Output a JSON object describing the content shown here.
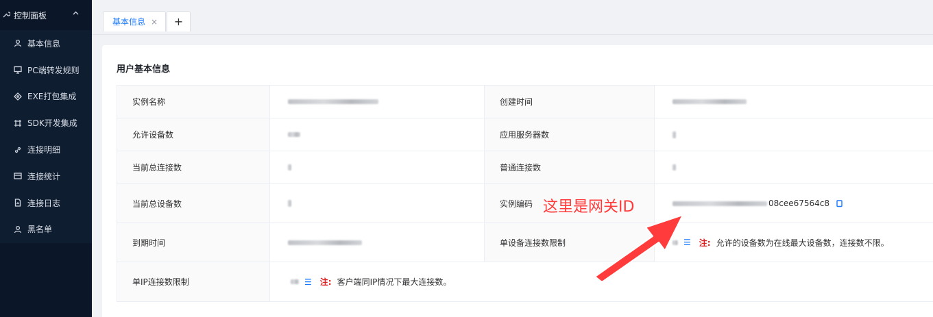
{
  "sidebar": {
    "header": {
      "label": "控制面板",
      "icon": "wrench-icon",
      "chevron": "chevron-up-icon"
    },
    "items": [
      {
        "label": "基本信息",
        "icon": "user-icon"
      },
      {
        "label": "PC端转发规则",
        "icon": "monitor-icon"
      },
      {
        "label": "EXE打包集成",
        "icon": "diamond-icon"
      },
      {
        "label": "SDK开发集成",
        "icon": "frame-icon"
      },
      {
        "label": "连接明细",
        "icon": "link-icon"
      },
      {
        "label": "连接统计",
        "icon": "table-icon"
      },
      {
        "label": "连接日志",
        "icon": "file-icon"
      },
      {
        "label": "黑名单",
        "icon": "user-icon"
      }
    ]
  },
  "tabs": {
    "active_label": "基本信息",
    "close_glyph": "×",
    "add_glyph": "+"
  },
  "card": {
    "title": "用户基本信息",
    "rows": [
      {
        "l1": "实例名称",
        "l2": "创建时间"
      },
      {
        "l1": "允许设备数",
        "l2": "应用服务器数"
      },
      {
        "l1": "当前总连接数",
        "l2": "普通连接数"
      },
      {
        "l1": "当前总设备数",
        "l2": "实例编码",
        "v2_suffix": "08cee67564c8"
      },
      {
        "l1": "到期时间",
        "l2": "单设备连接数限制",
        "v2_note_prefix": "注:",
        "v2_note": "允许的设备数为在线最大设备数，连接数不限。"
      },
      {
        "l1": "单IP连接数限制",
        "v1_note_prefix": "注:",
        "v1_note": "客户端同IP情况下最大连接数。"
      }
    ]
  },
  "annotation": {
    "text": "这里是网关ID",
    "color": "#ff3b3b"
  },
  "colors": {
    "sidebar_bg": "#0f1d31",
    "accent": "#1677ff",
    "note_red": "#e02020"
  }
}
